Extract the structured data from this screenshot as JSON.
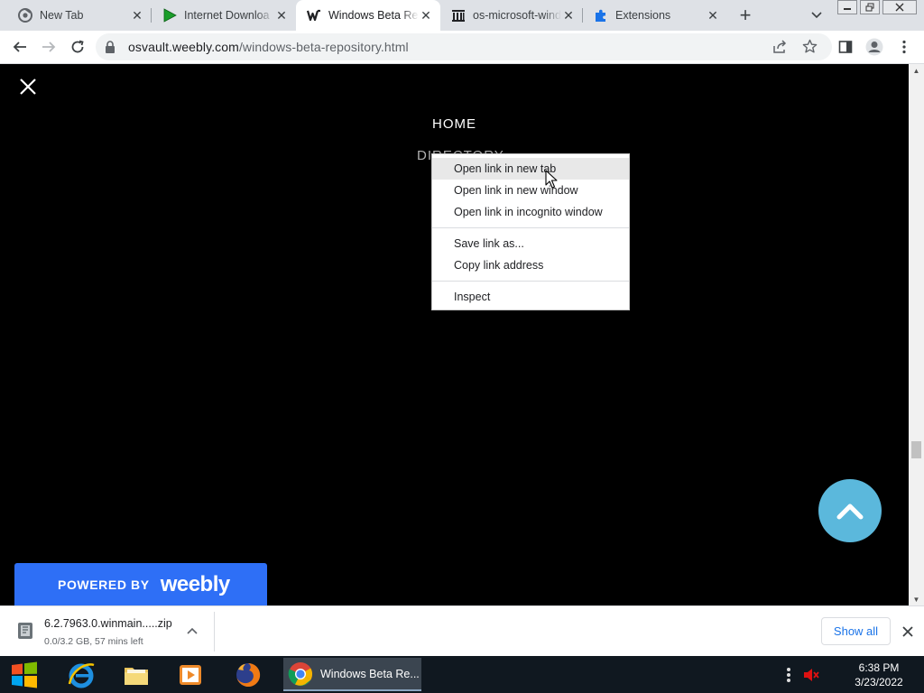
{
  "browser": {
    "tabs": [
      {
        "title": "New Tab",
        "icon": "chrome-icon",
        "active": false
      },
      {
        "title": "Internet Downloa",
        "icon": "play-icon",
        "active": false
      },
      {
        "title": "Windows Beta Re",
        "icon": "weebly-icon",
        "active": true
      },
      {
        "title": "os-microsoft-wind",
        "icon": "archive-icon",
        "active": false
      },
      {
        "title": "Extensions",
        "icon": "puzzle-icon",
        "active": false
      }
    ],
    "url": {
      "host": "osvault.weebly.com",
      "path": "/windows-beta-repository.html"
    }
  },
  "page": {
    "nav": {
      "home": "HOME",
      "directory": "DIRECTORY"
    },
    "powered": {
      "prefix": "POWERED BY",
      "brand": "weebly"
    },
    "colors": {
      "background": "#000000",
      "powered_bg": "#2e6ff6",
      "back_to_top": "#5bb8dc"
    }
  },
  "context_menu": {
    "items": [
      {
        "label": "Open link in new tab",
        "highlighted": true
      },
      {
        "label": "Open link in new window"
      },
      {
        "label": "Open link in incognito window"
      },
      {
        "label": "Save link as..."
      },
      {
        "label": "Copy link address"
      },
      {
        "label": "Inspect"
      }
    ]
  },
  "download_shelf": {
    "file_name": "6.2.7963.0.winmain.....zip",
    "status": "0.0/3.2 GB, 57 mins left",
    "show_all": "Show all"
  },
  "taskbar": {
    "active_app": "Windows Beta Re...",
    "time": "6:38 PM",
    "date": "3/23/2022"
  }
}
